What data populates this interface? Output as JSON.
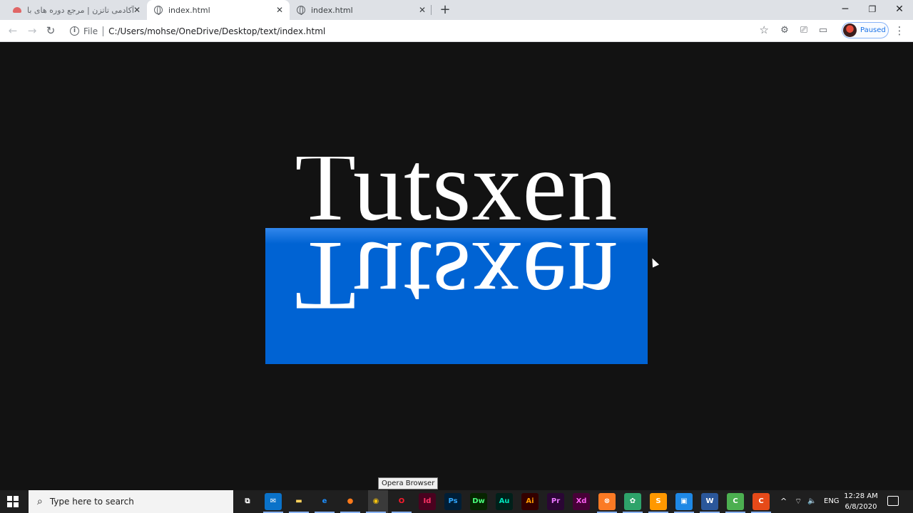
{
  "browser": {
    "tabs": [
      {
        "title": "آکادمی تاتزن | مرجع دوره های با ک",
        "favicon": "tutsxen-red-icon",
        "active": false
      },
      {
        "title": "index.html",
        "favicon": "globe-icon",
        "active": true
      },
      {
        "title": "index.html",
        "favicon": "globe-icon",
        "active": false
      }
    ],
    "new_tab": "+",
    "window_controls": {
      "minimize": "─",
      "maximize": "❐",
      "close": "✕"
    },
    "nav": {
      "back": "←",
      "forward": "→",
      "reload": "↻"
    },
    "address": {
      "scheme_label": "File",
      "url": "C:/Users/mohse/OneDrive/Desktop/text/index.html"
    },
    "bookmark_icon": "☆",
    "profile_label": "Paused",
    "menu": "⋮"
  },
  "page": {
    "word": "Tutsxen",
    "reflection_color": "#0063d3",
    "background": "#121212"
  },
  "tooltip": "Opera Browser",
  "taskbar": {
    "search_placeholder": "Type here to search",
    "apps": [
      {
        "name": "task-view-icon",
        "label": "⧉",
        "color": "#ffffff",
        "bg": "transparent"
      },
      {
        "name": "mail-icon",
        "label": "✉",
        "color": "#ffffff",
        "bg": "#0a72c9"
      },
      {
        "name": "file-explorer-icon",
        "label": "▬",
        "color": "#ffd35c",
        "bg": "transparent"
      },
      {
        "name": "edge-icon",
        "label": "e",
        "color": "#1e90ff",
        "bg": "transparent"
      },
      {
        "name": "firefox-icon",
        "label": "●",
        "color": "#ff7a1a",
        "bg": "transparent"
      },
      {
        "name": "chrome-icon",
        "label": "◉",
        "color": "#f4c20d",
        "bg": "transparent"
      },
      {
        "name": "opera-icon",
        "label": "O",
        "color": "#ff1b2d",
        "bg": "transparent"
      },
      {
        "name": "indesign-icon",
        "label": "Id",
        "color": "#ff3366",
        "bg": "#49021f"
      },
      {
        "name": "photoshop-icon",
        "label": "Ps",
        "color": "#31a8ff",
        "bg": "#001e36"
      },
      {
        "name": "dreamweaver-icon",
        "label": "Dw",
        "color": "#4aff7b",
        "bg": "#072401"
      },
      {
        "name": "audition-icon",
        "label": "Au",
        "color": "#00e4bb",
        "bg": "#00201a"
      },
      {
        "name": "illustrator-icon",
        "label": "Ai",
        "color": "#ff9a00",
        "bg": "#330000"
      },
      {
        "name": "premiere-icon",
        "label": "Pr",
        "color": "#ea77ff",
        "bg": "#2a0634"
      },
      {
        "name": "xd-icon",
        "label": "Xd",
        "color": "#ff61f6",
        "bg": "#470137"
      },
      {
        "name": "xampp-icon",
        "label": "⊗",
        "color": "#ffffff",
        "bg": "#fb7a24"
      },
      {
        "name": "green-app-icon",
        "label": "✿",
        "color": "#ffffff",
        "bg": "#2ea36a"
      },
      {
        "name": "sublime-icon",
        "label": "S",
        "color": "#ffffff",
        "bg": "#ff9800"
      },
      {
        "name": "blue-app-icon",
        "label": "▣",
        "color": "#ffffff",
        "bg": "#1e88e5"
      },
      {
        "name": "word-icon",
        "label": "W",
        "color": "#ffffff",
        "bg": "#2b579a"
      },
      {
        "name": "camtasia-icon",
        "label": "C",
        "color": "#ffffff",
        "bg": "#4caf50"
      },
      {
        "name": "red-app-icon",
        "label": "C",
        "color": "#ffffff",
        "bg": "#e64a19"
      }
    ],
    "tray": {
      "chevron": "^",
      "network": "⌔",
      "volume": "🔈",
      "lang": "ENG"
    },
    "time": "12:28 AM",
    "date": "6/8/2020"
  }
}
